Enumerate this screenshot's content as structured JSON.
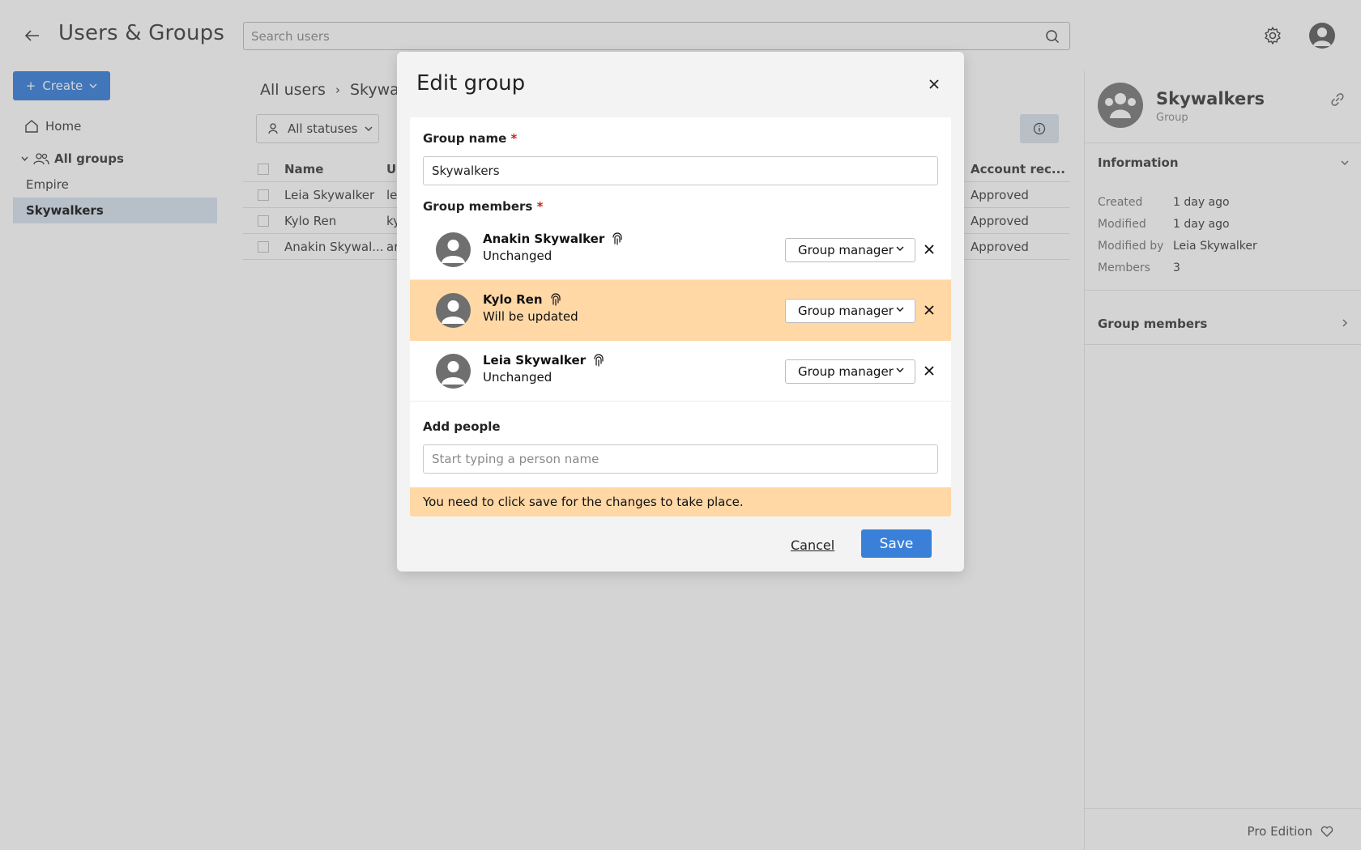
{
  "app": {
    "title": "Users & Groups",
    "search_placeholder": "Search users",
    "create_label": "Create"
  },
  "nav": {
    "home": "Home",
    "all_groups": "All groups",
    "groups": [
      "Empire",
      "Skywalkers"
    ],
    "active_group": "Skywalkers"
  },
  "breadcrumb": {
    "root": "All users",
    "separator": "›",
    "current": "Skywalke"
  },
  "filter": {
    "label": "All statuses"
  },
  "table": {
    "columns": {
      "name": "Name",
      "username": "Us",
      "account": "Account rec..."
    },
    "rows": [
      {
        "name": "Leia Skywalker",
        "username": "le",
        "account": "Approved"
      },
      {
        "name": "Kylo Ren",
        "username": "ky",
        "account": "Approved"
      },
      {
        "name": "Anakin Skywal...",
        "username": "ar",
        "account": "Approved"
      }
    ]
  },
  "right_panel": {
    "name": "Skywalkers",
    "type": "Group",
    "information_label": "Information",
    "info": [
      {
        "key": "Created",
        "value": "1 day ago"
      },
      {
        "key": "Modified",
        "value": "1 day ago"
      },
      {
        "key": "Modified by",
        "value": "Leia Skywalker"
      },
      {
        "key": "Members",
        "value": "3"
      }
    ],
    "group_members_label": "Group members",
    "edition": "Pro Edition"
  },
  "dialog": {
    "title": "Edit group",
    "group_name_label": "Group name",
    "required_mark": "*",
    "group_name_value": "Skywalkers",
    "group_members_label": "Group members",
    "members": [
      {
        "name": "Anakin Skywalker",
        "status": "Unchanged",
        "role": "Group manager",
        "changed": false
      },
      {
        "name": "Kylo Ren",
        "status": "Will be updated",
        "role": "Group manager",
        "changed": true
      },
      {
        "name": "Leia Skywalker",
        "status": "Unchanged",
        "role": "Group manager",
        "changed": false
      }
    ],
    "add_people_label": "Add people",
    "add_people_placeholder": "Start typing a person name",
    "notice": "You need to click save for the changes to take place.",
    "cancel_label": "Cancel",
    "save_label": "Save"
  },
  "colors": {
    "primary": "#3a80d9",
    "changed_highlight": "#ffd8a6",
    "required": "#cc1f1f"
  }
}
